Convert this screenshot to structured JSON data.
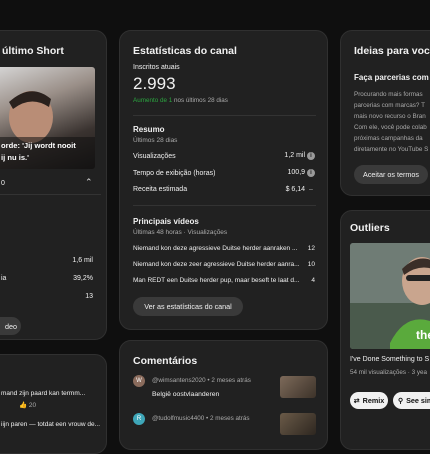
{
  "short": {
    "title": "último Short",
    "caption_line1": "orde: 'Jij wordt nooit",
    "caption_line2": "ij nu is.'",
    "stat_partial": "0",
    "rows": [
      {
        "label": "",
        "value": "1,6 mil"
      },
      {
        "label": "ia",
        "value": "39,2%"
      },
      {
        "label": "",
        "value": "13"
      }
    ],
    "button": "deo"
  },
  "channel": {
    "title": "Estatísticas do canal",
    "subs_label": "Inscritos atuais",
    "subs_value": "2.993",
    "growth": "Aumento de 1",
    "growth_period": " nos últimos 28 dias",
    "summary_title": "Resumo",
    "summary_period": "Últimos 28 dias",
    "summary_rows": [
      {
        "label": "Visualizações",
        "value": "1,2 mil",
        "icon": "info-icon"
      },
      {
        "label": "Tempo de exibição (horas)",
        "value": "100,9",
        "icon": "info-icon"
      },
      {
        "label": "Receita estimada",
        "value": "$ 6,14",
        "icon": "dash"
      }
    ],
    "videos_title": "Principais vídeos",
    "videos_sub": "Últimas 48 horas · Visualizações",
    "videos": [
      {
        "title": "Niemand kon deze agressieve Duitse herder aanraken ...",
        "views": "12"
      },
      {
        "title": "Niemand kon deze zeer agressieve Duitse herder aanra...",
        "views": "10"
      },
      {
        "title": "Man REDT een Duitse herder pup, maar beseft te laat d...",
        "views": "4"
      }
    ],
    "button": "Ver as estatísticas do canal"
  },
  "ideas": {
    "title": "Ideias para você",
    "subtitle": "Faça parcerias com m",
    "body_lines": [
      "Procurando mais formas",
      "parcerias com marcas? T",
      "mais novo recurso o Bran",
      "Com ele, você pode colab",
      "próximas campanhas da",
      "diretamente no YouTube S"
    ],
    "button": "Aceitar os termos"
  },
  "outliers": {
    "title": "Outliers",
    "video_title": "I've Done Something to S",
    "video_meta": "54 mil visualizações · 3 yea",
    "remix": "Remix",
    "see": "See simi"
  },
  "comments_left": {
    "line1": "mand zijn paard kan termm...",
    "likes": "20",
    "line2": "iijn paren — totdat een vrouw de..."
  },
  "comments": {
    "title": "Comentários",
    "items": [
      {
        "author": "@wimsantens2020",
        "time": "2 meses atrás",
        "text": "België oostvlaanderen",
        "avatar": "W",
        "avatar_color": "#5b8bd6"
      },
      {
        "author": "@tudolfmusic4400",
        "time": "2 meses atrás",
        "text": "",
        "avatar": "R",
        "avatar_color": "#3ea6b8"
      }
    ]
  },
  "colors": {
    "growth": "#2ba640",
    "background": "#0f0f0f",
    "card": "#212121"
  }
}
